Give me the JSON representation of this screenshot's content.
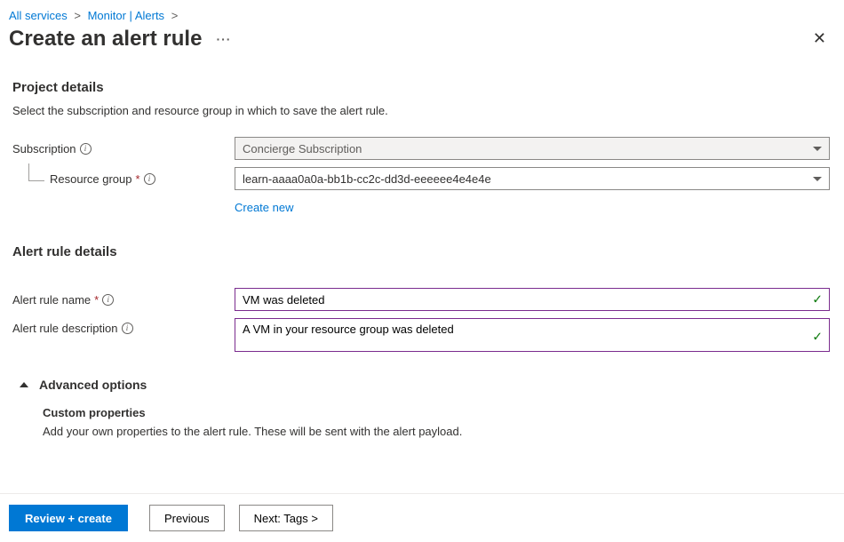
{
  "breadcrumb": {
    "item1": "All services",
    "item2": "Monitor | Alerts"
  },
  "header": {
    "title": "Create an alert rule"
  },
  "project_details": {
    "title": "Project details",
    "desc": "Select the subscription and resource group in which to save the alert rule.",
    "subscription_label": "Subscription",
    "subscription_value": "Concierge Subscription",
    "resource_group_label": "Resource group",
    "resource_group_value": "learn-aaaa0a0a-bb1b-cc2c-dd3d-eeeeee4e4e4e",
    "create_new": "Create new"
  },
  "alert_details": {
    "title": "Alert rule details",
    "name_label": "Alert rule name",
    "name_value": "VM was deleted",
    "desc_label": "Alert rule description",
    "desc_value": "A VM in your resource group was deleted"
  },
  "advanced": {
    "label": "Advanced options",
    "custom_title": "Custom properties",
    "custom_desc": "Add your own properties to the alert rule. These will be sent with the alert payload."
  },
  "footer": {
    "review": "Review + create",
    "previous": "Previous",
    "next": "Next: Tags >"
  }
}
